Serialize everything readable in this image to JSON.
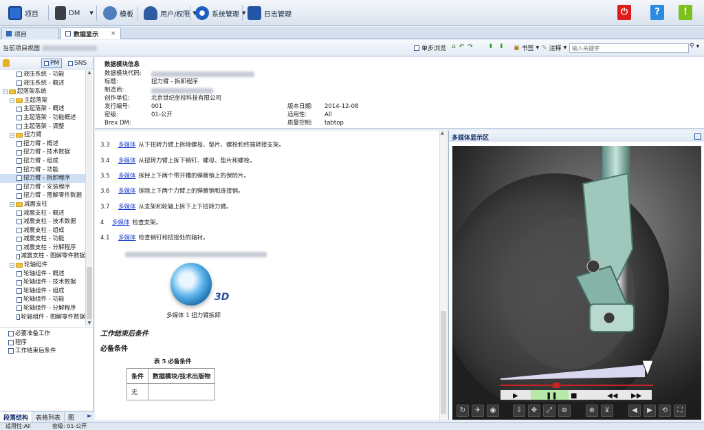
{
  "toolbar": {
    "project": "项目",
    "dm": "DM",
    "template": "模板",
    "users": "用户/权限",
    "sysmgmt": "系统管理",
    "logmgmt": "日志管理"
  },
  "tabs": {
    "project": "项目",
    "data_display": "数据显示"
  },
  "bar2": {
    "current_view": "当前项目视图",
    "step_browse": "单步浏览",
    "bookmark": "书签",
    "note": "注释",
    "search_placeholder": "输入关键字"
  },
  "left": {
    "pm": "PM",
    "sns": "SNS",
    "tree": [
      {
        "label": "液压系统 - 功能",
        "level": 2,
        "type": "doc"
      },
      {
        "label": "液压系统 - 概述",
        "level": 2,
        "type": "doc"
      },
      {
        "label": "起落架系统",
        "level": 0,
        "type": "folder"
      },
      {
        "label": "主起落架",
        "level": 1,
        "type": "folder"
      },
      {
        "label": "主起落架 - 概述",
        "level": 2,
        "type": "doc"
      },
      {
        "label": "主起落架 - 功能概述",
        "level": 2,
        "type": "doc"
      },
      {
        "label": "主起落架 - 调整",
        "level": 2,
        "type": "doc"
      },
      {
        "label": "扭力臂",
        "level": 1,
        "type": "folder"
      },
      {
        "label": "扭力臂 - 概述",
        "level": 2,
        "type": "doc"
      },
      {
        "label": "扭力臂 - 技术数据",
        "level": 2,
        "type": "doc"
      },
      {
        "label": "扭力臂 - 组成",
        "level": 2,
        "type": "doc"
      },
      {
        "label": "扭力臂 - 功能",
        "level": 2,
        "type": "doc"
      },
      {
        "label": "扭力臂 - 拆卸程序",
        "level": 2,
        "type": "doc",
        "selected": true
      },
      {
        "label": "扭力臂 - 安装程序",
        "level": 2,
        "type": "doc"
      },
      {
        "label": "扭力臂 - 图解零件数据",
        "level": 2,
        "type": "doc"
      },
      {
        "label": "减震支柱",
        "level": 1,
        "type": "folder"
      },
      {
        "label": "减震支柱 - 概述",
        "level": 2,
        "type": "doc"
      },
      {
        "label": "减震支柱 - 技术数据",
        "level": 2,
        "type": "doc"
      },
      {
        "label": "减震支柱 - 组成",
        "level": 2,
        "type": "doc"
      },
      {
        "label": "减震支柱 - 功能",
        "level": 2,
        "type": "doc"
      },
      {
        "label": "减震支柱 - 分解程序",
        "level": 2,
        "type": "doc"
      },
      {
        "label": "减震支柱 - 图解零件数据",
        "level": 2,
        "type": "doc"
      },
      {
        "label": "轮轴组件",
        "level": 1,
        "type": "folder"
      },
      {
        "label": "轮轴组件 - 概述",
        "level": 2,
        "type": "doc"
      },
      {
        "label": "轮轴组件 - 技术数据",
        "level": 2,
        "type": "doc"
      },
      {
        "label": "轮轴组件 - 组成",
        "level": 2,
        "type": "doc"
      },
      {
        "label": "轮轴组件 - 功能",
        "level": 2,
        "type": "doc"
      },
      {
        "label": "轮轴组件 - 分解程序",
        "level": 2,
        "type": "doc"
      },
      {
        "label": "轮轴组件 - 图解零件数据",
        "level": 2,
        "type": "doc"
      }
    ],
    "outline": [
      "必要准备工作",
      "程序",
      "工作结束后条件"
    ],
    "bottom_tabs": [
      "段落结构",
      "表格列表",
      "图"
    ]
  },
  "info": {
    "heading": "数据模块信息",
    "code_label": "数据模块代码:",
    "title_label": "标题:",
    "title_value": "扭力臂 - 拆卸程序",
    "maker_label": "制造商:",
    "creator_label": "创作单位:",
    "creator_value": "北京世纪坐标科技有限公司",
    "issue_label": "发行编号:",
    "issue_value": "001",
    "security_label": "密级:",
    "security_value": "01-公开",
    "brex_label": "Brex DM:",
    "date_label": "版本日期:",
    "date_value": "2014-12-08",
    "applic_label": "适用性:",
    "applic_value": "All",
    "qa_label": "质量控制:",
    "qa_value": "tabtop"
  },
  "content": {
    "media_link": "多媒体",
    "steps": [
      {
        "num": "3.3",
        "text": "从下扭转力臂上拆除螺母、垫片、螺栓和终端转接支架。"
      },
      {
        "num": "3.4",
        "text": "从扭转力臂上拆下销钉、螺母、垫片和螺栓。"
      },
      {
        "num": "3.5",
        "text": "拆掉上下两个带开槽的弹簧销上的保险片。"
      },
      {
        "num": "3.6",
        "text": "拆除上下两个力臂上的弹簧销和连接销。"
      },
      {
        "num": "3.7",
        "text": "从支架和轮轴上拆下上下扭转力臂。"
      },
      {
        "num": "4",
        "text": "检查支架。"
      },
      {
        "num": "4.1",
        "text": "检查销钉和扭接处的轴衬。"
      }
    ],
    "logo_text": "3D",
    "caption": "多媒体 1 扭力臂拆卸",
    "after_heading": "工作结束后条件",
    "req_heading": "必备条件",
    "table_title": "表 5 必备条件",
    "table_headers": [
      "条件",
      "数据模块/技术出版物"
    ],
    "table_rows": [
      [
        "无",
        ""
      ]
    ]
  },
  "media": {
    "title": "多媒体显示区"
  },
  "status": {
    "applic": "适用性:All",
    "security": "密级: 01-公开"
  }
}
